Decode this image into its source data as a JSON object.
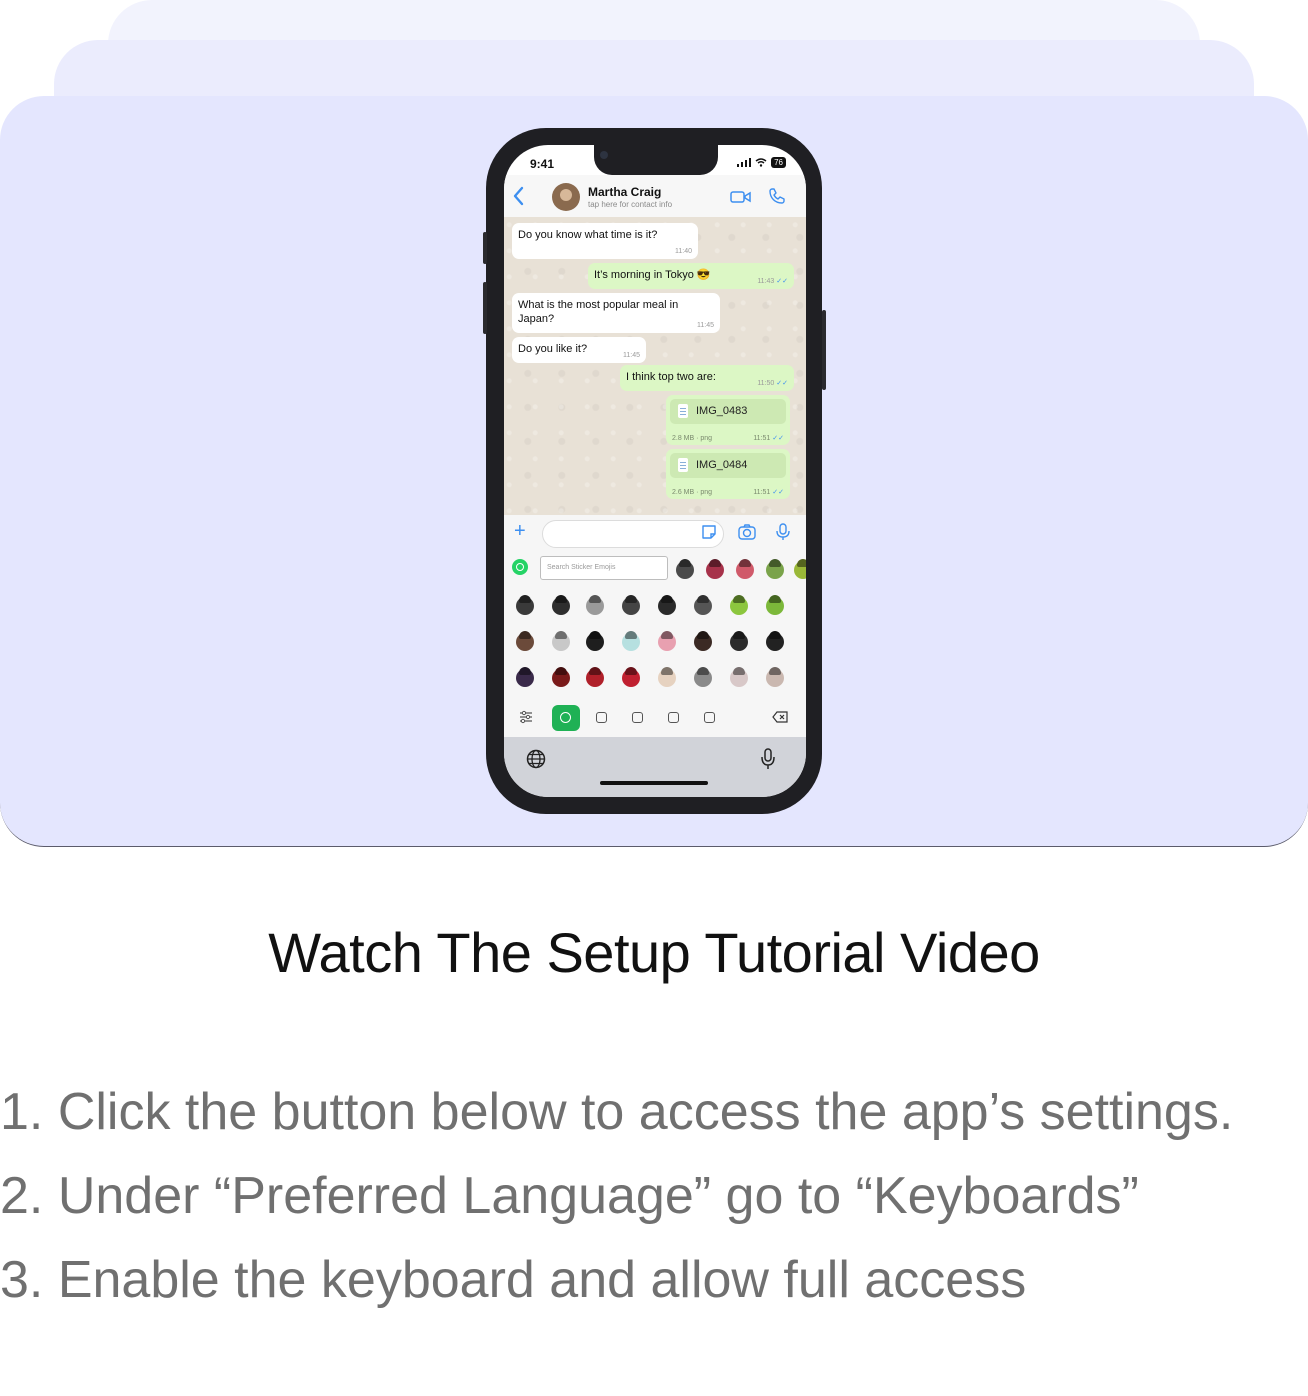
{
  "phone": {
    "status_time": "9:41",
    "battery": "76",
    "contact": {
      "name": "Martha Craig",
      "subtitle": "tap here for contact info"
    },
    "messages": [
      {
        "dir": "in",
        "text": "Do you know what time is it?",
        "time": "11:40"
      },
      {
        "dir": "out",
        "text": "It’s morning in Tokyo 😎",
        "time": "11:43"
      },
      {
        "dir": "in",
        "text": "What is the most popular meal in Japan?",
        "time": "11:45"
      },
      {
        "dir": "in",
        "text": "Do you like it?",
        "time": "11:45"
      },
      {
        "dir": "out",
        "text": "I think top two are:",
        "time": "11:50"
      }
    ],
    "files": [
      {
        "name": "IMG_0483",
        "meta": "2.8 MB · png",
        "time": "11:51"
      },
      {
        "name": "IMG_0484",
        "meta": "2.6 MB · png",
        "time": "11:51"
      }
    ],
    "sticker_search_placeholder": "Search Sticker Emojis"
  },
  "title": "Watch The Setup Tutorial Video",
  "steps": [
    "1. Click the button below to access the app’s settings.",
    "2. Under “Preferred Language” go to “Keyboards”",
    "3. Enable the keyboard and allow full access"
  ],
  "colors": {
    "card": "#e4e6fe",
    "whatsapp_green": "#1fb155",
    "ios_blue": "#3d8ff0",
    "outgoing_bubble": "#dcf7c5"
  }
}
